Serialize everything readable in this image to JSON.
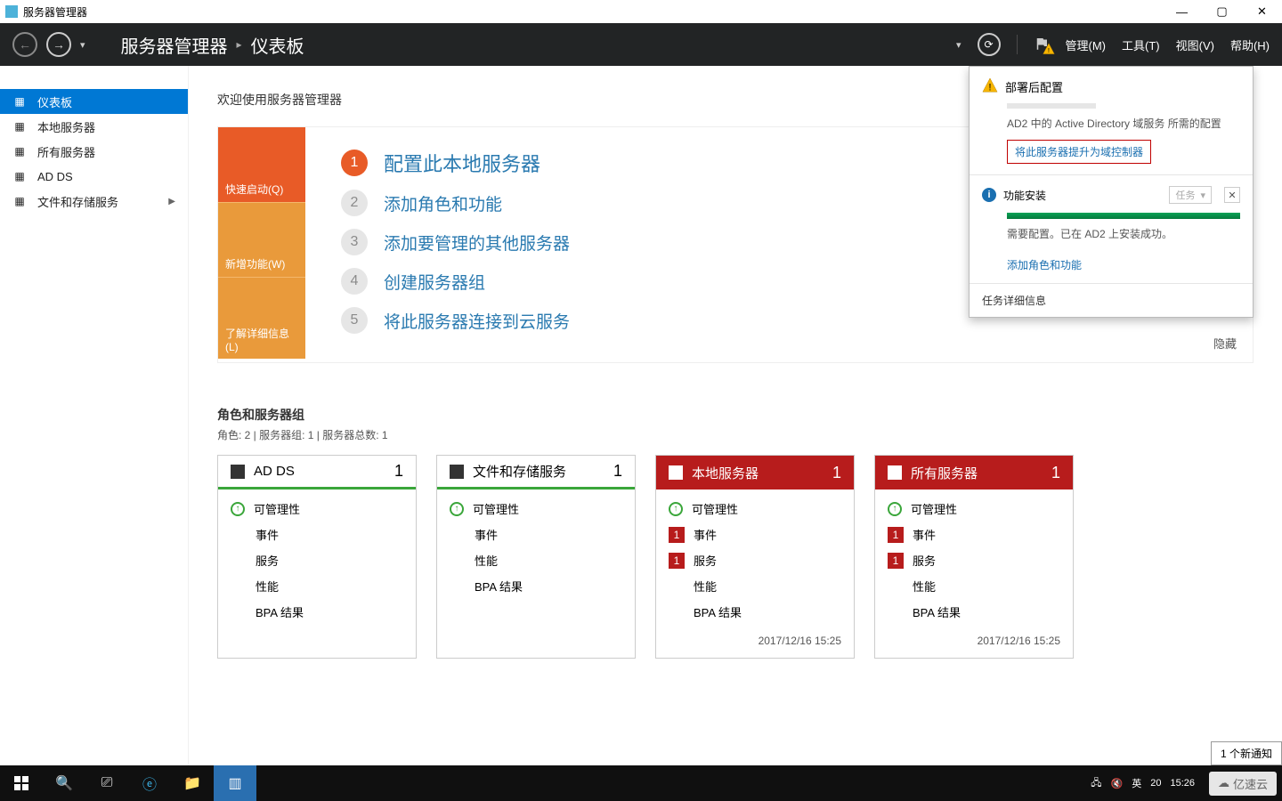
{
  "window": {
    "title": "服务器管理器"
  },
  "header": {
    "crumb1": "服务器管理器",
    "crumb2": "仪表板",
    "menus": {
      "manage": "管理(M)",
      "tools": "工具(T)",
      "view": "视图(V)",
      "help": "帮助(H)"
    }
  },
  "sidebar": {
    "items": [
      {
        "label": "仪表板",
        "icon": "dashboard-icon",
        "active": true
      },
      {
        "label": "本地服务器",
        "icon": "local-server-icon"
      },
      {
        "label": "所有服务器",
        "icon": "all-servers-icon"
      },
      {
        "label": "AD DS",
        "icon": "adds-icon"
      },
      {
        "label": "文件和存储服务",
        "icon": "files-icon",
        "chevron": true
      }
    ]
  },
  "welcome": {
    "title": "欢迎使用服务器管理器",
    "tabs": {
      "quick": "快速启动(Q)",
      "new": "新增功能(W)",
      "learn": "了解详细信息(L)"
    },
    "steps": [
      "配置此本地服务器",
      "添加角色和功能",
      "添加要管理的其他服务器",
      "创建服务器组",
      "将此服务器连接到云服务"
    ],
    "hide": "隐藏"
  },
  "groups": {
    "title": "角色和服务器组",
    "sub": "角色: 2 | 服务器组: 1 | 服务器总数: 1"
  },
  "tiles": [
    {
      "title": "AD DS",
      "count": "1",
      "red": false,
      "rows": [
        {
          "icon": "up",
          "label": "可管理性"
        },
        {
          "icon": "",
          "label": "事件"
        },
        {
          "icon": "",
          "label": "服务"
        },
        {
          "icon": "",
          "label": "性能"
        },
        {
          "icon": "",
          "label": "BPA 结果"
        }
      ],
      "foot": ""
    },
    {
      "title": "文件和存储服务",
      "count": "1",
      "red": false,
      "rows": [
        {
          "icon": "up",
          "label": "可管理性"
        },
        {
          "icon": "",
          "label": "事件"
        },
        {
          "icon": "",
          "label": "性能"
        },
        {
          "icon": "",
          "label": "BPA 结果"
        }
      ],
      "foot": ""
    },
    {
      "title": "本地服务器",
      "count": "1",
      "red": true,
      "rows": [
        {
          "icon": "up",
          "label": "可管理性"
        },
        {
          "icon": "badge",
          "label": "事件"
        },
        {
          "icon": "badge",
          "label": "服务"
        },
        {
          "icon": "",
          "label": "性能"
        },
        {
          "icon": "",
          "label": "BPA 结果"
        }
      ],
      "foot": "2017/12/16 15:25"
    },
    {
      "title": "所有服务器",
      "count": "1",
      "red": true,
      "rows": [
        {
          "icon": "up",
          "label": "可管理性"
        },
        {
          "icon": "badge",
          "label": "事件"
        },
        {
          "icon": "badge",
          "label": "服务"
        },
        {
          "icon": "",
          "label": "性能"
        },
        {
          "icon": "",
          "label": "BPA 结果"
        }
      ],
      "foot": "2017/12/16 15:25"
    }
  ],
  "notif": {
    "sec1_title": "部署后配置",
    "sec1_desc": "AD2 中的 Active Directory 域服务 所需的配置",
    "sec1_link": "将此服务器提升为域控制器",
    "sec2_title": "功能安装",
    "tasks": "任务",
    "sec2_desc": "需要配置。已在 AD2 上安装成功。",
    "sec2_link": "添加角色和功能",
    "detail": "任务详细信息"
  },
  "newnotif": "1 个新通知",
  "taskbar": {
    "ime": "英",
    "time": "15:26",
    "date_short": "20",
    "brand": "亿速云"
  }
}
